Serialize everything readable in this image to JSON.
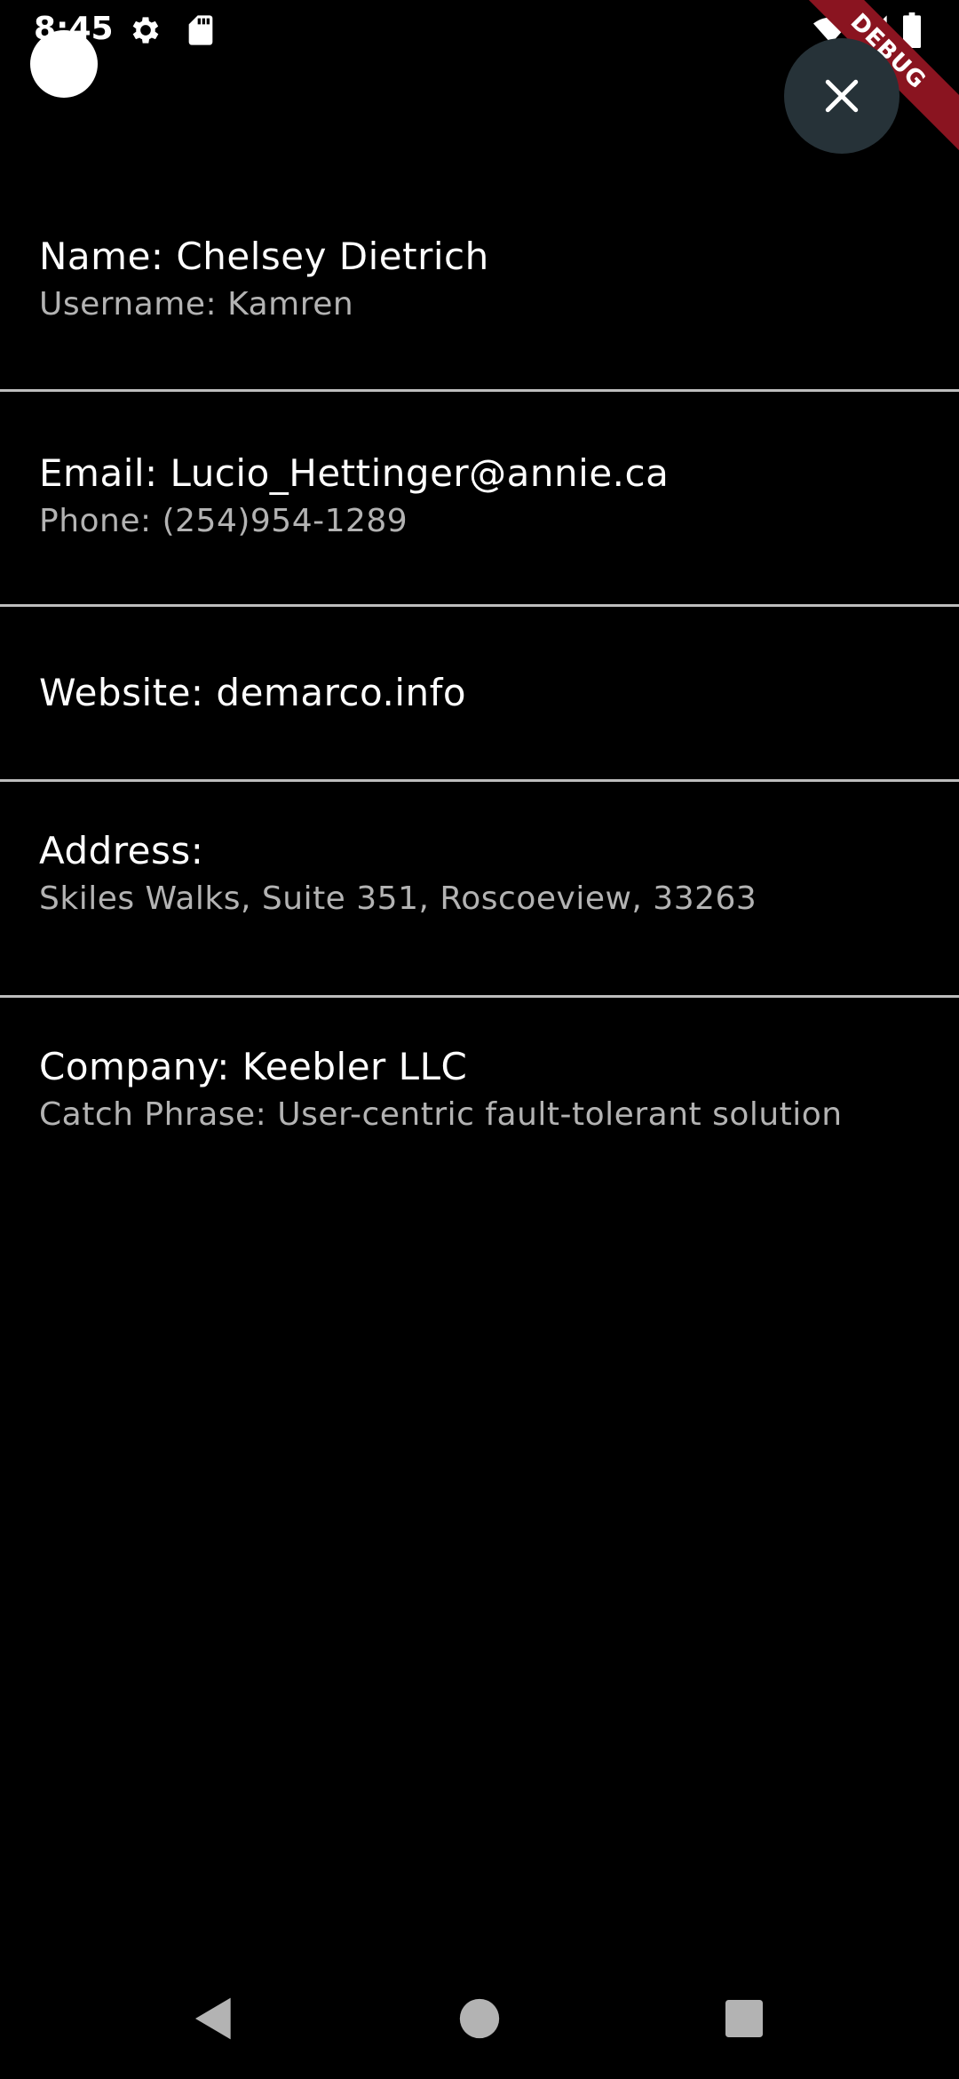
{
  "status_bar": {
    "time": "8:45",
    "icons": [
      "gear-icon",
      "sd-card-icon",
      "wifi-icon",
      "signal-icon",
      "battery-icon"
    ]
  },
  "debug_banner": {
    "label": "DEBUG",
    "color": "#8a1420"
  },
  "close_button": {
    "icon": "close-icon",
    "background": "#263238"
  },
  "details": {
    "name": "Name: Chelsey Dietrich",
    "username": "Username: Kamren",
    "email": "Email: Lucio_Hettinger@annie.ca",
    "phone": "Phone: (254)954-1289",
    "website": "Website: demarco.info",
    "address_label": "Address:",
    "address": "Skiles Walks, Suite 351, Roscoeview, 33263",
    "company": "Company: Keebler LLC",
    "catch_phrase": "Catch Phrase: User-centric fault-tolerant solution"
  },
  "nav_bar": {
    "icons": [
      "back-icon",
      "home-icon",
      "recents-icon"
    ]
  }
}
